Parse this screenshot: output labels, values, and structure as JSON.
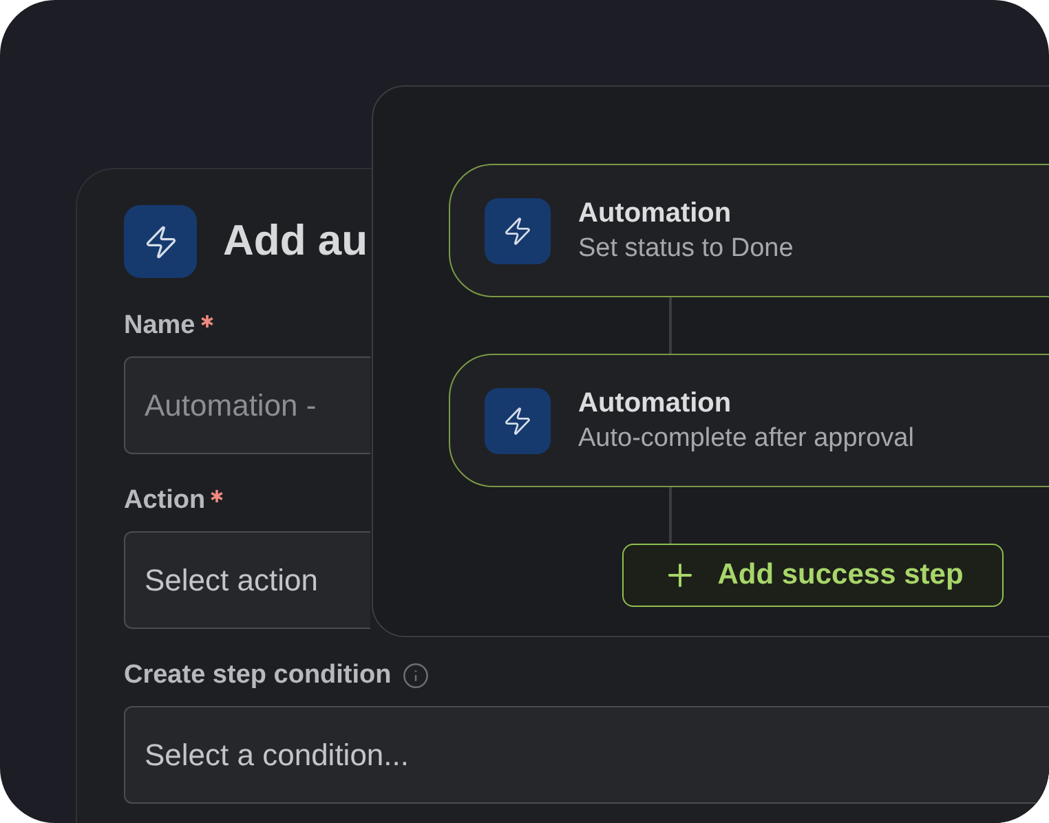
{
  "dialog": {
    "title": "Add au",
    "fields": [
      {
        "label": "Name",
        "required": true,
        "info": false,
        "value": "Automation -"
      },
      {
        "label": "Action",
        "required": true,
        "info": false,
        "placeholder": "Select action"
      },
      {
        "label": "Create step condition",
        "required": false,
        "info": true,
        "placeholder": "Select a condition..."
      }
    ]
  },
  "flow": {
    "steps": [
      {
        "title": "Automation",
        "subtitle": "Set status to Done"
      },
      {
        "title": "Automation",
        "subtitle": "Auto-complete after approval"
      }
    ],
    "add_button": "Add success step"
  }
}
